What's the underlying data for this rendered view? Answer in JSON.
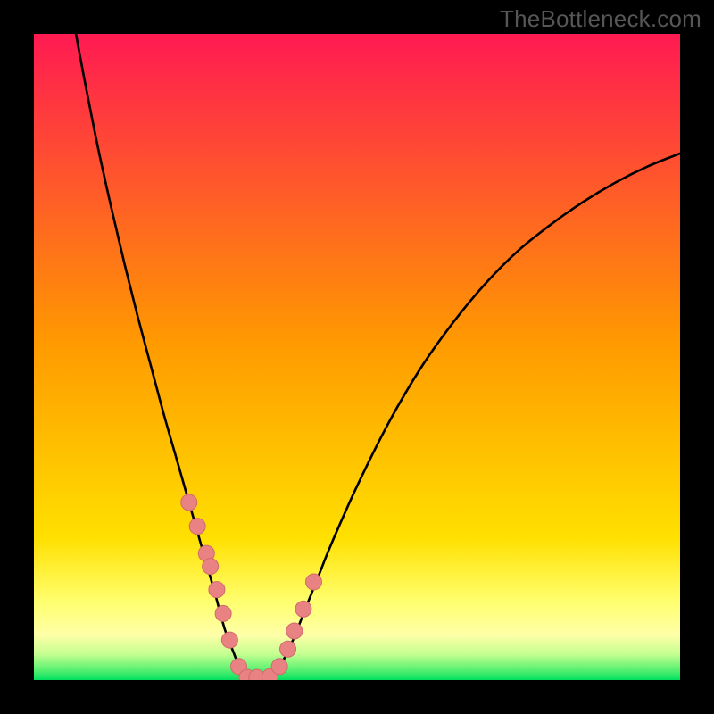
{
  "watermark": {
    "text": "TheBottleneck.com"
  },
  "colors": {
    "black": "#000000",
    "curve": "#000000",
    "marker_fill": "#e98383",
    "marker_stroke": "#d06a6a",
    "grad_top": "#ff1a52",
    "grad_mid": "#ffd400",
    "grad_yellow": "#ffff8a",
    "grad_green1": "#7ff58c",
    "grad_green2": "#00e060"
  },
  "chart_data": {
    "type": "line",
    "title": "",
    "xlabel": "",
    "ylabel": "",
    "xlim": [
      0,
      100
    ],
    "ylim": [
      0,
      100
    ],
    "grid": false,
    "series": [
      {
        "name": "left-branch",
        "x": [
          6.5,
          8,
          10,
          12,
          14,
          16,
          18,
          20,
          22,
          24,
          26,
          28,
          29.5,
          31,
          32,
          33
        ],
        "y": [
          100,
          92,
          82,
          73,
          64.5,
          56.5,
          49,
          41.5,
          34.5,
          27.5,
          20.5,
          13.5,
          8,
          4,
          1.5,
          0.2
        ]
      },
      {
        "name": "right-branch",
        "x": [
          36.5,
          38,
          40,
          42,
          44,
          46,
          50,
          55,
          60,
          65,
          70,
          75,
          80,
          85,
          90,
          95,
          100
        ],
        "y": [
          0.2,
          2,
          6,
          11,
          16,
          21,
          30,
          40,
          48.5,
          55.5,
          61.5,
          66.5,
          70.5,
          74,
          77,
          79.5,
          81.5
        ]
      },
      {
        "name": "valley-floor",
        "x": [
          33,
          34,
          35,
          36,
          36.5
        ],
        "y": [
          0.2,
          0,
          0,
          0,
          0.2
        ]
      }
    ],
    "markers": {
      "name": "data-points",
      "x": [
        24.0,
        25.3,
        26.7,
        27.3,
        28.3,
        29.3,
        30.3,
        31.7,
        33.0,
        34.5,
        36.5,
        38.0,
        39.3,
        40.3,
        41.7,
        43.3
      ],
      "y": [
        27.5,
        23.8,
        19.6,
        17.6,
        14.0,
        10.3,
        6.2,
        2.1,
        0.4,
        0.4,
        0.5,
        2.1,
        4.8,
        7.6,
        11.0,
        15.2
      ]
    },
    "gradient_bands": [
      {
        "from_y": 100,
        "to_y": 15,
        "color_top": "#ff1a52",
        "color_bottom": "#ffd400"
      },
      {
        "from_y": 15,
        "to_y": 10,
        "color_top": "#ffd400",
        "color_bottom": "#ffff8a"
      },
      {
        "from_y": 10,
        "to_y": 6,
        "color_top": "#ffff8a",
        "color_bottom": "#ffff8a"
      },
      {
        "from_y": 6,
        "to_y": 0.5,
        "color_top": "#ffffb0",
        "color_bottom": "#00e060"
      }
    ]
  }
}
